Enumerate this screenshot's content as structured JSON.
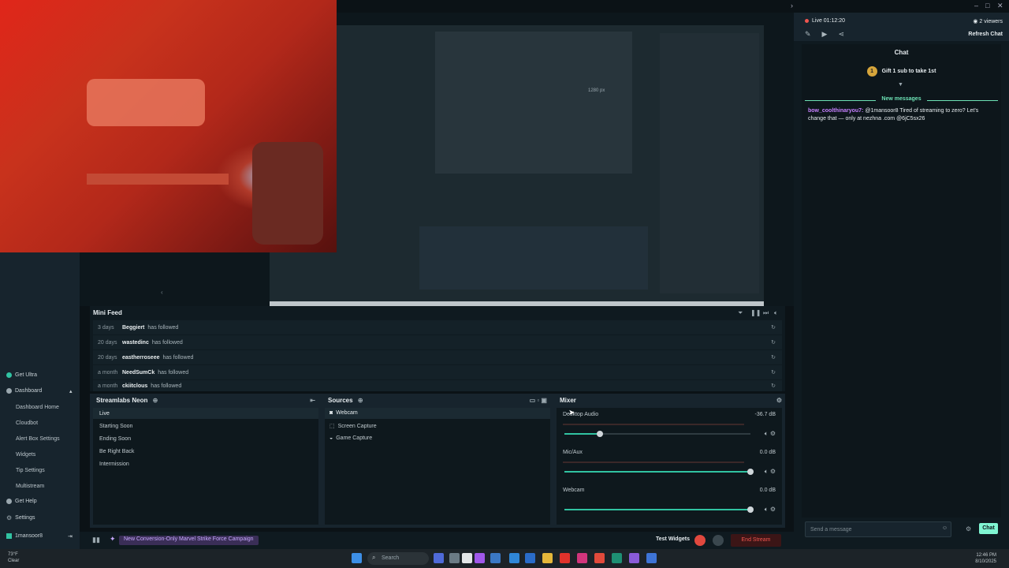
{
  "colors": {
    "accent": "#31c3a2",
    "live": "#f0554f",
    "newMessages": "#6de2b5",
    "username": "#c781ff",
    "campaign": "#c7a8ff",
    "gift": "#d6a53b"
  },
  "editor": {
    "preview_resolution": "1280 px"
  },
  "nav": {
    "get_ultra": "Get Ultra",
    "dashboard": "Dashboard",
    "subs": [
      "Dashboard Home",
      "Cloudbot",
      "Alert Box Settings",
      "Widgets",
      "Tip Settings",
      "Multistream"
    ],
    "get_help": "Get Help",
    "settings": "Settings",
    "user": "1mansoor8"
  },
  "minifeed": {
    "title": "Mini Feed",
    "rows": [
      {
        "time": "3 days",
        "name": "Beggiert",
        "action": "has followed"
      },
      {
        "time": "20 days",
        "name": "wastedinc",
        "action": "has followed"
      },
      {
        "time": "20 days",
        "name": "eastherroseee",
        "action": "has followed"
      },
      {
        "time": "a month",
        "name": "NeedSumCk",
        "action": "has followed"
      },
      {
        "time": "a month",
        "name": "ckiitclous",
        "action": "has followed"
      }
    ]
  },
  "scenes": {
    "title": "Streamlabs Neon",
    "items": [
      "Live",
      "Starting Soon",
      "Ending Soon",
      "Be Right Back",
      "Intermission"
    ]
  },
  "sources": {
    "title": "Sources",
    "items": [
      {
        "label": "Webcam",
        "icon": "webcam-icon"
      },
      {
        "label": "Screen Capture",
        "icon": "screen-icon"
      },
      {
        "label": "Game Capture",
        "icon": "gamepad-icon"
      }
    ]
  },
  "mixer": {
    "title": "Mixer",
    "channels": [
      {
        "name": "Desktop Audio",
        "db": "-36.7 dB",
        "level": 0.19
      },
      {
        "name": "Mic/Aux",
        "db": "0.0 dB",
        "level": 1.0
      },
      {
        "name": "Webcam",
        "db": "0.0 dB",
        "level": 1.0
      }
    ]
  },
  "footer": {
    "campaign": "New Conversion-Only Marvel Strike Force Campaign",
    "test_widgets": "Test Widgets",
    "end_stream": "End Stream"
  },
  "chat": {
    "live": "Live 01:12:20",
    "viewers": "2 viewers",
    "refresh": "Refresh Chat",
    "title": "Chat",
    "gift": "Gift 1 sub to take 1st",
    "new_messages": "New messages",
    "message_user": "bow_coolthinaryou7:",
    "message_text": "@1mansoor8 Tired of streaming to zero? Let's change that — only at nezhna .com @6jC5sx26",
    "input_placeholder": "Send a message",
    "send": "Chat"
  },
  "taskbar": {
    "weather_temp": "73°F",
    "weather_desc": "Clear",
    "search": "Search",
    "time": "12:46 PM",
    "date": "8/10/2025"
  }
}
